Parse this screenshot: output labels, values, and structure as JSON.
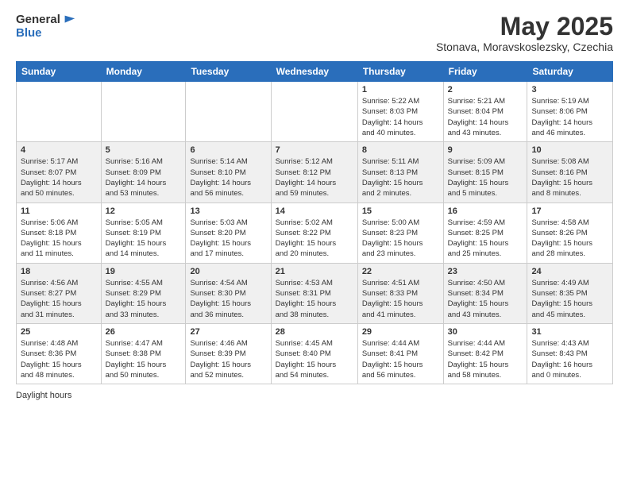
{
  "header": {
    "logo_general": "General",
    "logo_blue": "Blue",
    "month_title": "May 2025",
    "location": "Stonava, Moravskoslezsky, Czechia"
  },
  "days_of_week": [
    "Sunday",
    "Monday",
    "Tuesday",
    "Wednesday",
    "Thursday",
    "Friday",
    "Saturday"
  ],
  "footer": {
    "daylight_label": "Daylight hours"
  },
  "weeks": [
    [
      {
        "day": "",
        "info": ""
      },
      {
        "day": "",
        "info": ""
      },
      {
        "day": "",
        "info": ""
      },
      {
        "day": "",
        "info": ""
      },
      {
        "day": "1",
        "info": "Sunrise: 5:22 AM\nSunset: 8:03 PM\nDaylight: 14 hours\nand 40 minutes."
      },
      {
        "day": "2",
        "info": "Sunrise: 5:21 AM\nSunset: 8:04 PM\nDaylight: 14 hours\nand 43 minutes."
      },
      {
        "day": "3",
        "info": "Sunrise: 5:19 AM\nSunset: 8:06 PM\nDaylight: 14 hours\nand 46 minutes."
      }
    ],
    [
      {
        "day": "4",
        "info": "Sunrise: 5:17 AM\nSunset: 8:07 PM\nDaylight: 14 hours\nand 50 minutes."
      },
      {
        "day": "5",
        "info": "Sunrise: 5:16 AM\nSunset: 8:09 PM\nDaylight: 14 hours\nand 53 minutes."
      },
      {
        "day": "6",
        "info": "Sunrise: 5:14 AM\nSunset: 8:10 PM\nDaylight: 14 hours\nand 56 minutes."
      },
      {
        "day": "7",
        "info": "Sunrise: 5:12 AM\nSunset: 8:12 PM\nDaylight: 14 hours\nand 59 minutes."
      },
      {
        "day": "8",
        "info": "Sunrise: 5:11 AM\nSunset: 8:13 PM\nDaylight: 15 hours\nand 2 minutes."
      },
      {
        "day": "9",
        "info": "Sunrise: 5:09 AM\nSunset: 8:15 PM\nDaylight: 15 hours\nand 5 minutes."
      },
      {
        "day": "10",
        "info": "Sunrise: 5:08 AM\nSunset: 8:16 PM\nDaylight: 15 hours\nand 8 minutes."
      }
    ],
    [
      {
        "day": "11",
        "info": "Sunrise: 5:06 AM\nSunset: 8:18 PM\nDaylight: 15 hours\nand 11 minutes."
      },
      {
        "day": "12",
        "info": "Sunrise: 5:05 AM\nSunset: 8:19 PM\nDaylight: 15 hours\nand 14 minutes."
      },
      {
        "day": "13",
        "info": "Sunrise: 5:03 AM\nSunset: 8:20 PM\nDaylight: 15 hours\nand 17 minutes."
      },
      {
        "day": "14",
        "info": "Sunrise: 5:02 AM\nSunset: 8:22 PM\nDaylight: 15 hours\nand 20 minutes."
      },
      {
        "day": "15",
        "info": "Sunrise: 5:00 AM\nSunset: 8:23 PM\nDaylight: 15 hours\nand 23 minutes."
      },
      {
        "day": "16",
        "info": "Sunrise: 4:59 AM\nSunset: 8:25 PM\nDaylight: 15 hours\nand 25 minutes."
      },
      {
        "day": "17",
        "info": "Sunrise: 4:58 AM\nSunset: 8:26 PM\nDaylight: 15 hours\nand 28 minutes."
      }
    ],
    [
      {
        "day": "18",
        "info": "Sunrise: 4:56 AM\nSunset: 8:27 PM\nDaylight: 15 hours\nand 31 minutes."
      },
      {
        "day": "19",
        "info": "Sunrise: 4:55 AM\nSunset: 8:29 PM\nDaylight: 15 hours\nand 33 minutes."
      },
      {
        "day": "20",
        "info": "Sunrise: 4:54 AM\nSunset: 8:30 PM\nDaylight: 15 hours\nand 36 minutes."
      },
      {
        "day": "21",
        "info": "Sunrise: 4:53 AM\nSunset: 8:31 PM\nDaylight: 15 hours\nand 38 minutes."
      },
      {
        "day": "22",
        "info": "Sunrise: 4:51 AM\nSunset: 8:33 PM\nDaylight: 15 hours\nand 41 minutes."
      },
      {
        "day": "23",
        "info": "Sunrise: 4:50 AM\nSunset: 8:34 PM\nDaylight: 15 hours\nand 43 minutes."
      },
      {
        "day": "24",
        "info": "Sunrise: 4:49 AM\nSunset: 8:35 PM\nDaylight: 15 hours\nand 45 minutes."
      }
    ],
    [
      {
        "day": "25",
        "info": "Sunrise: 4:48 AM\nSunset: 8:36 PM\nDaylight: 15 hours\nand 48 minutes."
      },
      {
        "day": "26",
        "info": "Sunrise: 4:47 AM\nSunset: 8:38 PM\nDaylight: 15 hours\nand 50 minutes."
      },
      {
        "day": "27",
        "info": "Sunrise: 4:46 AM\nSunset: 8:39 PM\nDaylight: 15 hours\nand 52 minutes."
      },
      {
        "day": "28",
        "info": "Sunrise: 4:45 AM\nSunset: 8:40 PM\nDaylight: 15 hours\nand 54 minutes."
      },
      {
        "day": "29",
        "info": "Sunrise: 4:44 AM\nSunset: 8:41 PM\nDaylight: 15 hours\nand 56 minutes."
      },
      {
        "day": "30",
        "info": "Sunrise: 4:44 AM\nSunset: 8:42 PM\nDaylight: 15 hours\nand 58 minutes."
      },
      {
        "day": "31",
        "info": "Sunrise: 4:43 AM\nSunset: 8:43 PM\nDaylight: 16 hours\nand 0 minutes."
      }
    ]
  ]
}
